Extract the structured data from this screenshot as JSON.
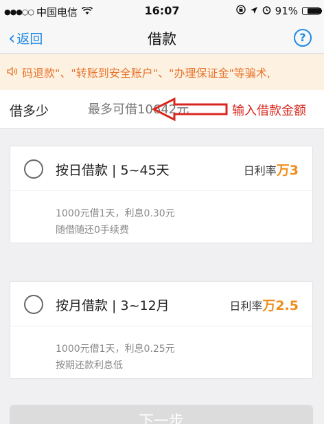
{
  "status_bar": {
    "signal": "●●●○○",
    "carrier": "中国电信",
    "wifi_icon": "wifi-icon",
    "time": "16:07",
    "battery": "91%"
  },
  "nav": {
    "back_label": "返回",
    "title": "借款",
    "help_label": "?"
  },
  "notice": {
    "text": "码退款\"、\"转账到安全账户\"、\"办理保证金\"等骗术,"
  },
  "amount": {
    "label": "借多少",
    "placeholder": "最多可借10642元",
    "annotation": "输入借款金额"
  },
  "plans": [
    {
      "title": "按日借款 | 5~45天",
      "rate_label": "日利率",
      "rate_value": "万3",
      "detail1": "1000元借1天，利息0.30元",
      "detail2": "随借随还0手续费"
    },
    {
      "title": "按月借款 | 3~12月",
      "rate_label": "日利率",
      "rate_value": "万2.5",
      "detail1": "1000元借1天，利息0.25元",
      "detail2": "按期还款利息低"
    }
  ],
  "next_button": "下一步",
  "colors": {
    "accent": "#1e88e5",
    "warning": "#e8742d",
    "rate": "#f08c1a",
    "annotation": "#d9261c"
  }
}
